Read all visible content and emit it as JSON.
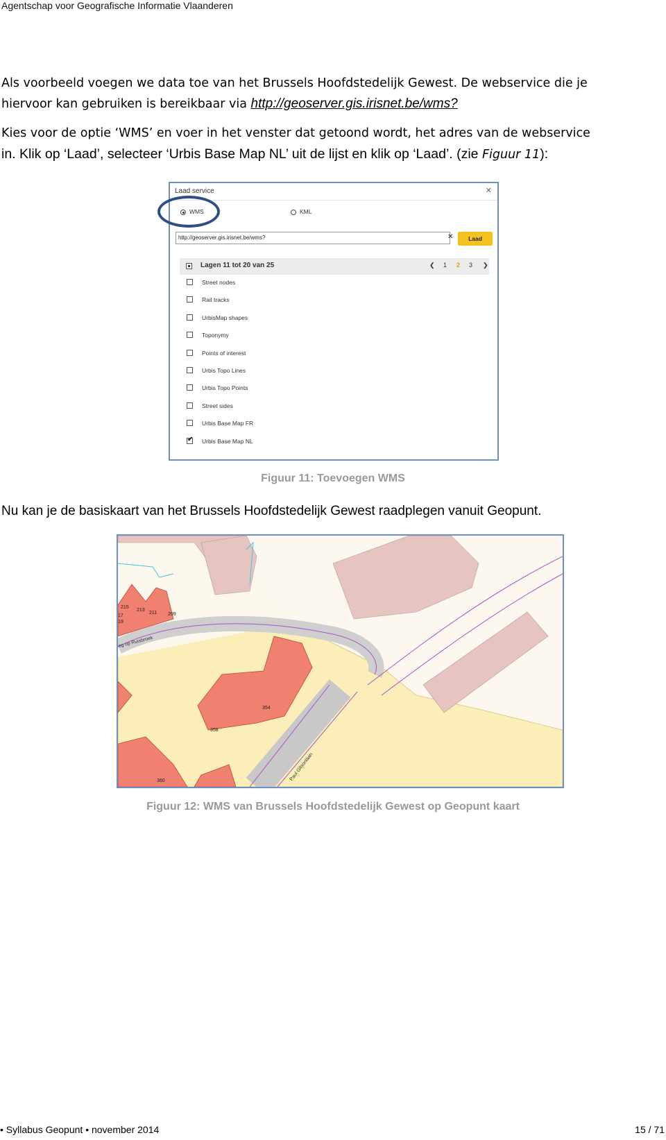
{
  "header": "Agentschap voor Geografische Informatie Vlaanderen",
  "para1": {
    "line1": "Als voorbeeld voegen we data toe van het Brussels Hoofdstedelijk Gewest. De webservice die je",
    "line2_prefix": "hiervoor kan gebruiken is bereikbaar via ",
    "link": "http://geoserver.gis.irisnet.be/wms?"
  },
  "para2": {
    "line1": "Kies voor de optie ‘WMS’ en voer in het venster dat getoond wordt, het adres van de webservice",
    "line2_prefix": "in. Klik op ‘Laad’, selecteer ‘Urbis Base Map NL’ uit de lijst en klik op ‘Laad’. (zie ",
    "line2_ref": "Figuur 11",
    "line2_suffix": "):"
  },
  "dialog": {
    "title": "Laad service",
    "close": "✕",
    "radio_wms": "WMS",
    "radio_kml": "KML",
    "selected_radio": "WMS",
    "url_value": "http://geoserver.gis.irisnet.be/wms?",
    "clear": "✕",
    "load_button": "Laad",
    "list_header": "Lagen 11 tot 20 van 25",
    "pager": {
      "prev": "❮",
      "pages": [
        "1",
        "2",
        "3"
      ],
      "current": "2",
      "next": "❯"
    },
    "layers": [
      {
        "label": "Street nodes",
        "checked": false
      },
      {
        "label": "Rail tracks",
        "checked": false
      },
      {
        "label": "UrbisMap shapes",
        "checked": false
      },
      {
        "label": "Toponymy",
        "checked": false
      },
      {
        "label": "Points of interest",
        "checked": false
      },
      {
        "label": "Urbis Topo Lines",
        "checked": false
      },
      {
        "label": "Urbis Topo Points",
        "checked": false
      },
      {
        "label": "Street sides",
        "checked": false
      },
      {
        "label": "Urbis Base Map FR",
        "checked": false
      },
      {
        "label": "Urbis Base Map NL",
        "checked": true
      }
    ]
  },
  "caption1": "Figuur 11: Toevoegen WMS",
  "para3": "Nu kan je de basiskaart van het Brussels Hoofdstedelijk Gewest raadplegen vanuit Geopunt.",
  "map_labels": {
    "n215": "215",
    "n213": "213",
    "n211": "211",
    "n209": "209",
    "n17": "17",
    "n19": "19",
    "n354": "354",
    "n358": "358",
    "n360": "360",
    "street1": "eg op Ruisbroek",
    "street2": "Paul Gilsonlaan"
  },
  "caption2": "Figuur 12: WMS van Brussels Hoofdstedelijk Gewest op Geopunt kaart",
  "footer_left": "• Syllabus Geopunt • november 2014",
  "footer_right": "15 / 71"
}
